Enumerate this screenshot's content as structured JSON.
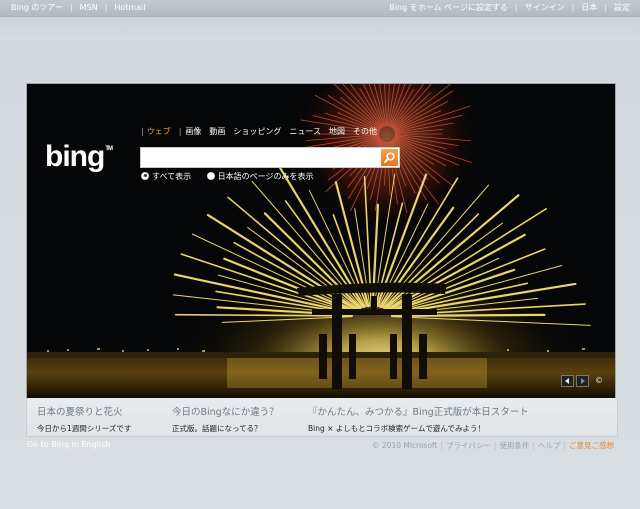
{
  "topbar": {
    "left": [
      "Bing のツアー",
      "MSN",
      "Hotmail"
    ],
    "right": [
      "Bing をホーム ページに設定する",
      "サインイン",
      "日本",
      "設定"
    ]
  },
  "logo": {
    "text": "bing",
    "tm": "TM"
  },
  "nav": {
    "items": [
      "ウェブ",
      "画像",
      "動画",
      "ショッピング",
      "ニュース",
      "地図",
      "その他"
    ],
    "active_index": 0
  },
  "search": {
    "value": "",
    "placeholder": ""
  },
  "radios": {
    "options": [
      "すべて表示",
      "日本語のページのみを表示"
    ],
    "selected_index": 0
  },
  "image_controls": {
    "copyright_glyph": "©"
  },
  "hotspots": [
    {
      "title": "日本の夏祭りと花火",
      "subtitle": "今日から1週間シリーズです"
    },
    {
      "title": "今日のBingなにか違う？",
      "subtitle": "正式版。話題になってる？"
    },
    {
      "title": "『かんたん、みつかる』Bing正式版が本日スタート",
      "subtitle": "Bing × よしもとコラボ検索ゲームで遊んでみよう！"
    }
  ],
  "footer": {
    "left": "Go to Bing in English",
    "copyright": "© 2010 Microsoft",
    "links": [
      "プライバシー",
      "使用条件",
      "ヘルプ"
    ],
    "feedback": "ご意見ご感想"
  },
  "colors": {
    "accent_orange": "#f7a43a",
    "search_button": "#e3781e",
    "hero_bg": "#050607"
  }
}
